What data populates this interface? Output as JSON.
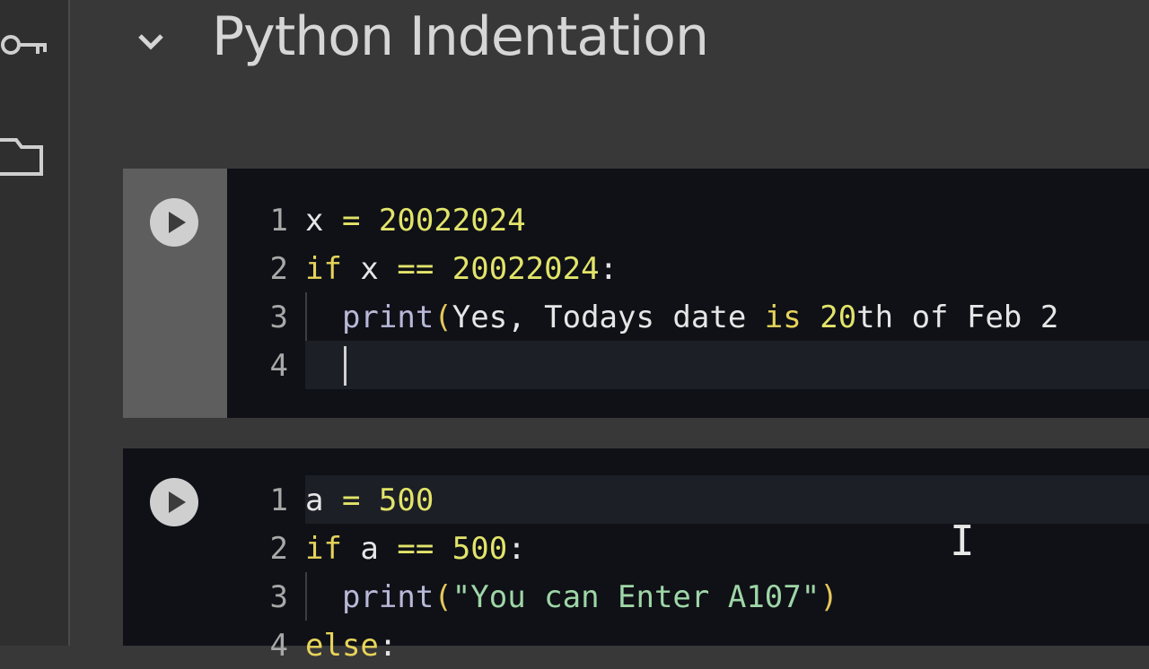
{
  "sidebar": {
    "icons": [
      {
        "name": "key-icon"
      },
      {
        "name": "folder-icon"
      }
    ]
  },
  "section": {
    "title": "Python Indentation"
  },
  "cells": [
    {
      "lines": [
        {
          "num": "1",
          "tokens": [
            [
              "plain",
              "x "
            ],
            [
              "op",
              "= "
            ],
            [
              "num-lit",
              "20022024"
            ]
          ]
        },
        {
          "num": "2",
          "tokens": [
            [
              "kw-if",
              "if "
            ],
            [
              "plain",
              "x "
            ],
            [
              "op",
              "== "
            ],
            [
              "num-lit",
              "20022024"
            ],
            [
              "plain",
              ":"
            ]
          ]
        },
        {
          "num": "3",
          "tokens": [
            [
              "plain",
              "  "
            ],
            [
              "fn",
              "print"
            ],
            [
              "paren",
              "("
            ],
            [
              "plain",
              "Yes, Todays date "
            ],
            [
              "kw-if",
              "is "
            ],
            [
              "num-lit",
              "20"
            ],
            [
              "plain",
              "th of Feb 2"
            ]
          ]
        },
        {
          "num": "4",
          "tokens": []
        }
      ]
    },
    {
      "lines": [
        {
          "num": "1",
          "tokens": [
            [
              "plain",
              "a "
            ],
            [
              "op",
              "= "
            ],
            [
              "num-lit",
              "500"
            ]
          ]
        },
        {
          "num": "2",
          "tokens": [
            [
              "kw-if",
              "if "
            ],
            [
              "plain",
              "a "
            ],
            [
              "op",
              "== "
            ],
            [
              "num-lit",
              "500"
            ],
            [
              "plain",
              ":"
            ]
          ]
        },
        {
          "num": "3",
          "tokens": [
            [
              "plain",
              "  "
            ],
            [
              "fn",
              "print"
            ],
            [
              "paren",
              "("
            ],
            [
              "str",
              "\"You can Enter A107\""
            ],
            [
              "paren",
              ")"
            ]
          ]
        },
        {
          "num": "4",
          "tokens": [
            [
              "kw-if",
              "else"
            ],
            [
              "plain",
              ":"
            ]
          ]
        }
      ]
    }
  ],
  "colors": {
    "background": "#383838",
    "cell_background": "#0f1117",
    "number_literal": "#e2e46a",
    "string_literal": "#9fd6a7"
  }
}
